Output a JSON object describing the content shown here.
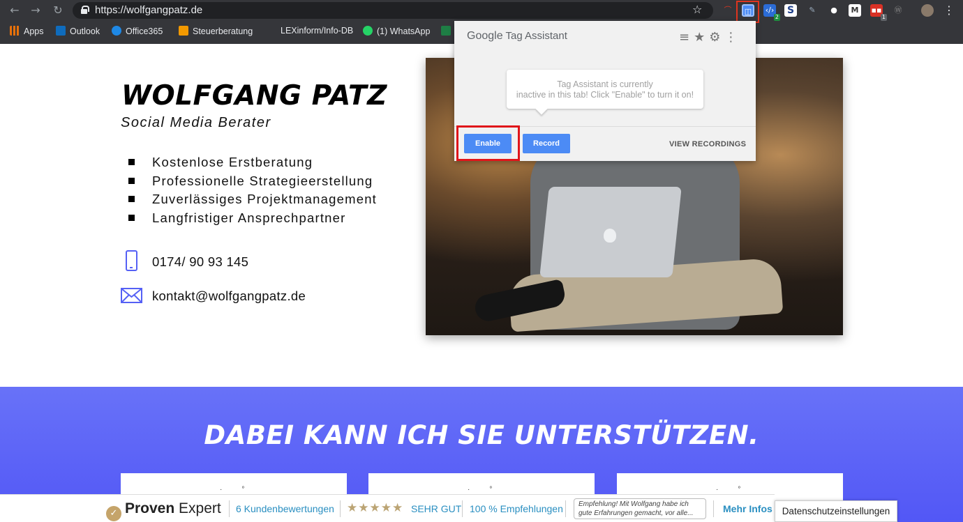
{
  "browser": {
    "url": "https://wolfgangpatz.de",
    "bookmarks": [
      {
        "label": "Apps",
        "color": "#e8710a"
      },
      {
        "label": "Outlook",
        "color": "#0f6cbd"
      },
      {
        "label": "Office365",
        "color": "#1e88e5"
      },
      {
        "label": "Steuerberatung",
        "color": "#f29900"
      },
      {
        "label": "LEXinform/Info-DB",
        "color": ""
      },
      {
        "label": "(1) WhatsApp",
        "color": "#25d366"
      }
    ],
    "extension_badges": {
      "ext3": "2",
      "ext9": "1"
    }
  },
  "hero": {
    "name": "WOLFGANG PATZ",
    "subtitle": "Social Media Berater",
    "bullets": [
      "Kostenlose Erstberatung",
      "Professionelle Strategieerstellung",
      "Zuverlässiges Projektmanagement",
      "Langfristiger Ansprechpartner"
    ],
    "phone": "0174/ 90 93 145",
    "email": "kontakt@wolfgangpatz.de"
  },
  "tag_assistant": {
    "title_brand": "Google",
    "title_product": "Tag Assistant",
    "message_line1": "Tag Assistant is currently",
    "message_line2": "inactive in this tab! Click \"Enable\" to turn it on!",
    "enable_label": "Enable",
    "record_label": "Record",
    "view_recordings_label": "VIEW RECORDINGS"
  },
  "services": {
    "title": "DABEI KANN ICH SIE UNTERSTÜTZEN."
  },
  "proven_expert": {
    "logo_bold": "Proven",
    "logo_light": "Expert",
    "reviews": "6 Kundenbewertungen",
    "stars": "★★★★★",
    "rating": "SEHR GUT",
    "recommendations": "100 % Empfehlungen",
    "quote": "Empfehlung! Mit Wolfgang habe ich gute Erfahrungen gemacht, vor alle...",
    "more": "Mehr Infos"
  },
  "privacy_button": "Datenschutzeinstellungen",
  "colors": {
    "accent": "#5560f5",
    "chrome": "#35363a",
    "tag_button": "#4c8bf5",
    "highlight": "#e0151a"
  }
}
